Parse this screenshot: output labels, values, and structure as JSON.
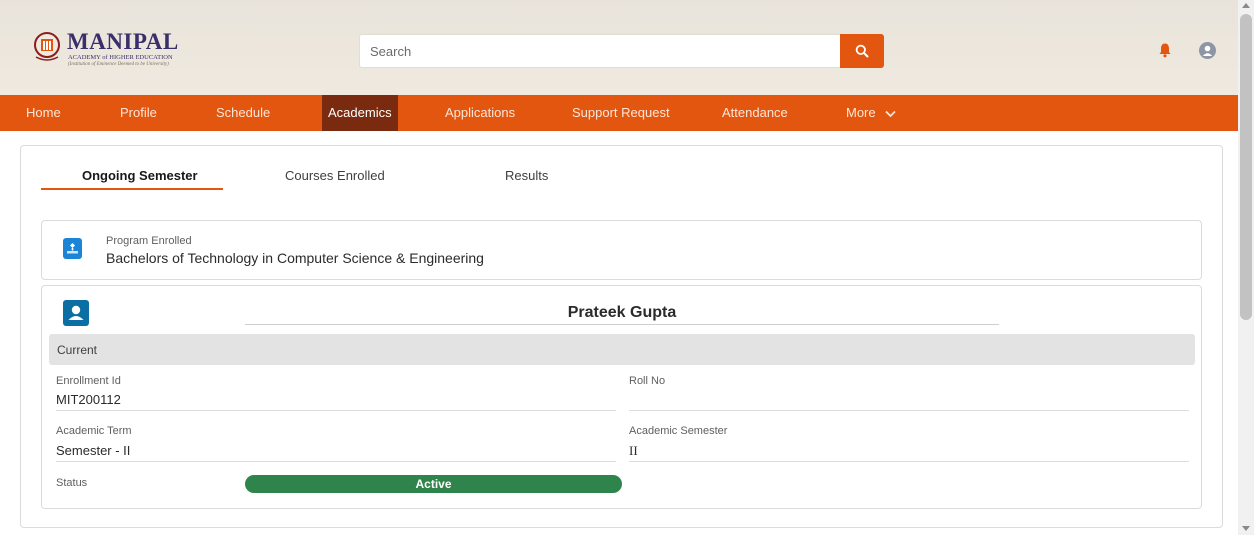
{
  "brand": {
    "name": "MANIPAL",
    "subtitle": "ACADEMY of HIGHER EDUCATION",
    "tagline": "(Institution of Eminence Deemed to be University)"
  },
  "search": {
    "placeholder": "Search"
  },
  "nav": {
    "items": [
      {
        "label": "Home"
      },
      {
        "label": "Profile"
      },
      {
        "label": "Schedule"
      },
      {
        "label": "Academics"
      },
      {
        "label": "Applications"
      },
      {
        "label": "Support Request"
      },
      {
        "label": "Attendance"
      },
      {
        "label": "More"
      }
    ],
    "active": "Academics"
  },
  "tabs": [
    {
      "label": "Ongoing Semester"
    },
    {
      "label": "Courses Enrolled"
    },
    {
      "label": "Results"
    }
  ],
  "program": {
    "label": "Program Enrolled",
    "value": "Bachelors of Technology in Computer Science & Engineering"
  },
  "student": {
    "name": "Prateek Gupta",
    "section": "Current",
    "enrollment_label": "Enrollment Id",
    "enrollment_value": "MIT200112",
    "roll_label": "Roll No",
    "roll_value": "",
    "term_label": "Academic Term",
    "term_value": "Semester - II",
    "semester_label": "Academic Semester",
    "semester_value": "II",
    "status_label": "Status",
    "status_value": "Active"
  },
  "colors": {
    "accent": "#e3560f",
    "nav_active": "#7a2a0e",
    "status_active": "#2e844a",
    "program_icon": "#1b84d6",
    "student_icon": "#0c6fa3"
  },
  "icons": {
    "search": "search-icon",
    "notifications": "bell-icon",
    "user": "user-avatar-icon",
    "program": "education-icon",
    "student": "contact-icon",
    "more": "chevron-down-icon"
  }
}
